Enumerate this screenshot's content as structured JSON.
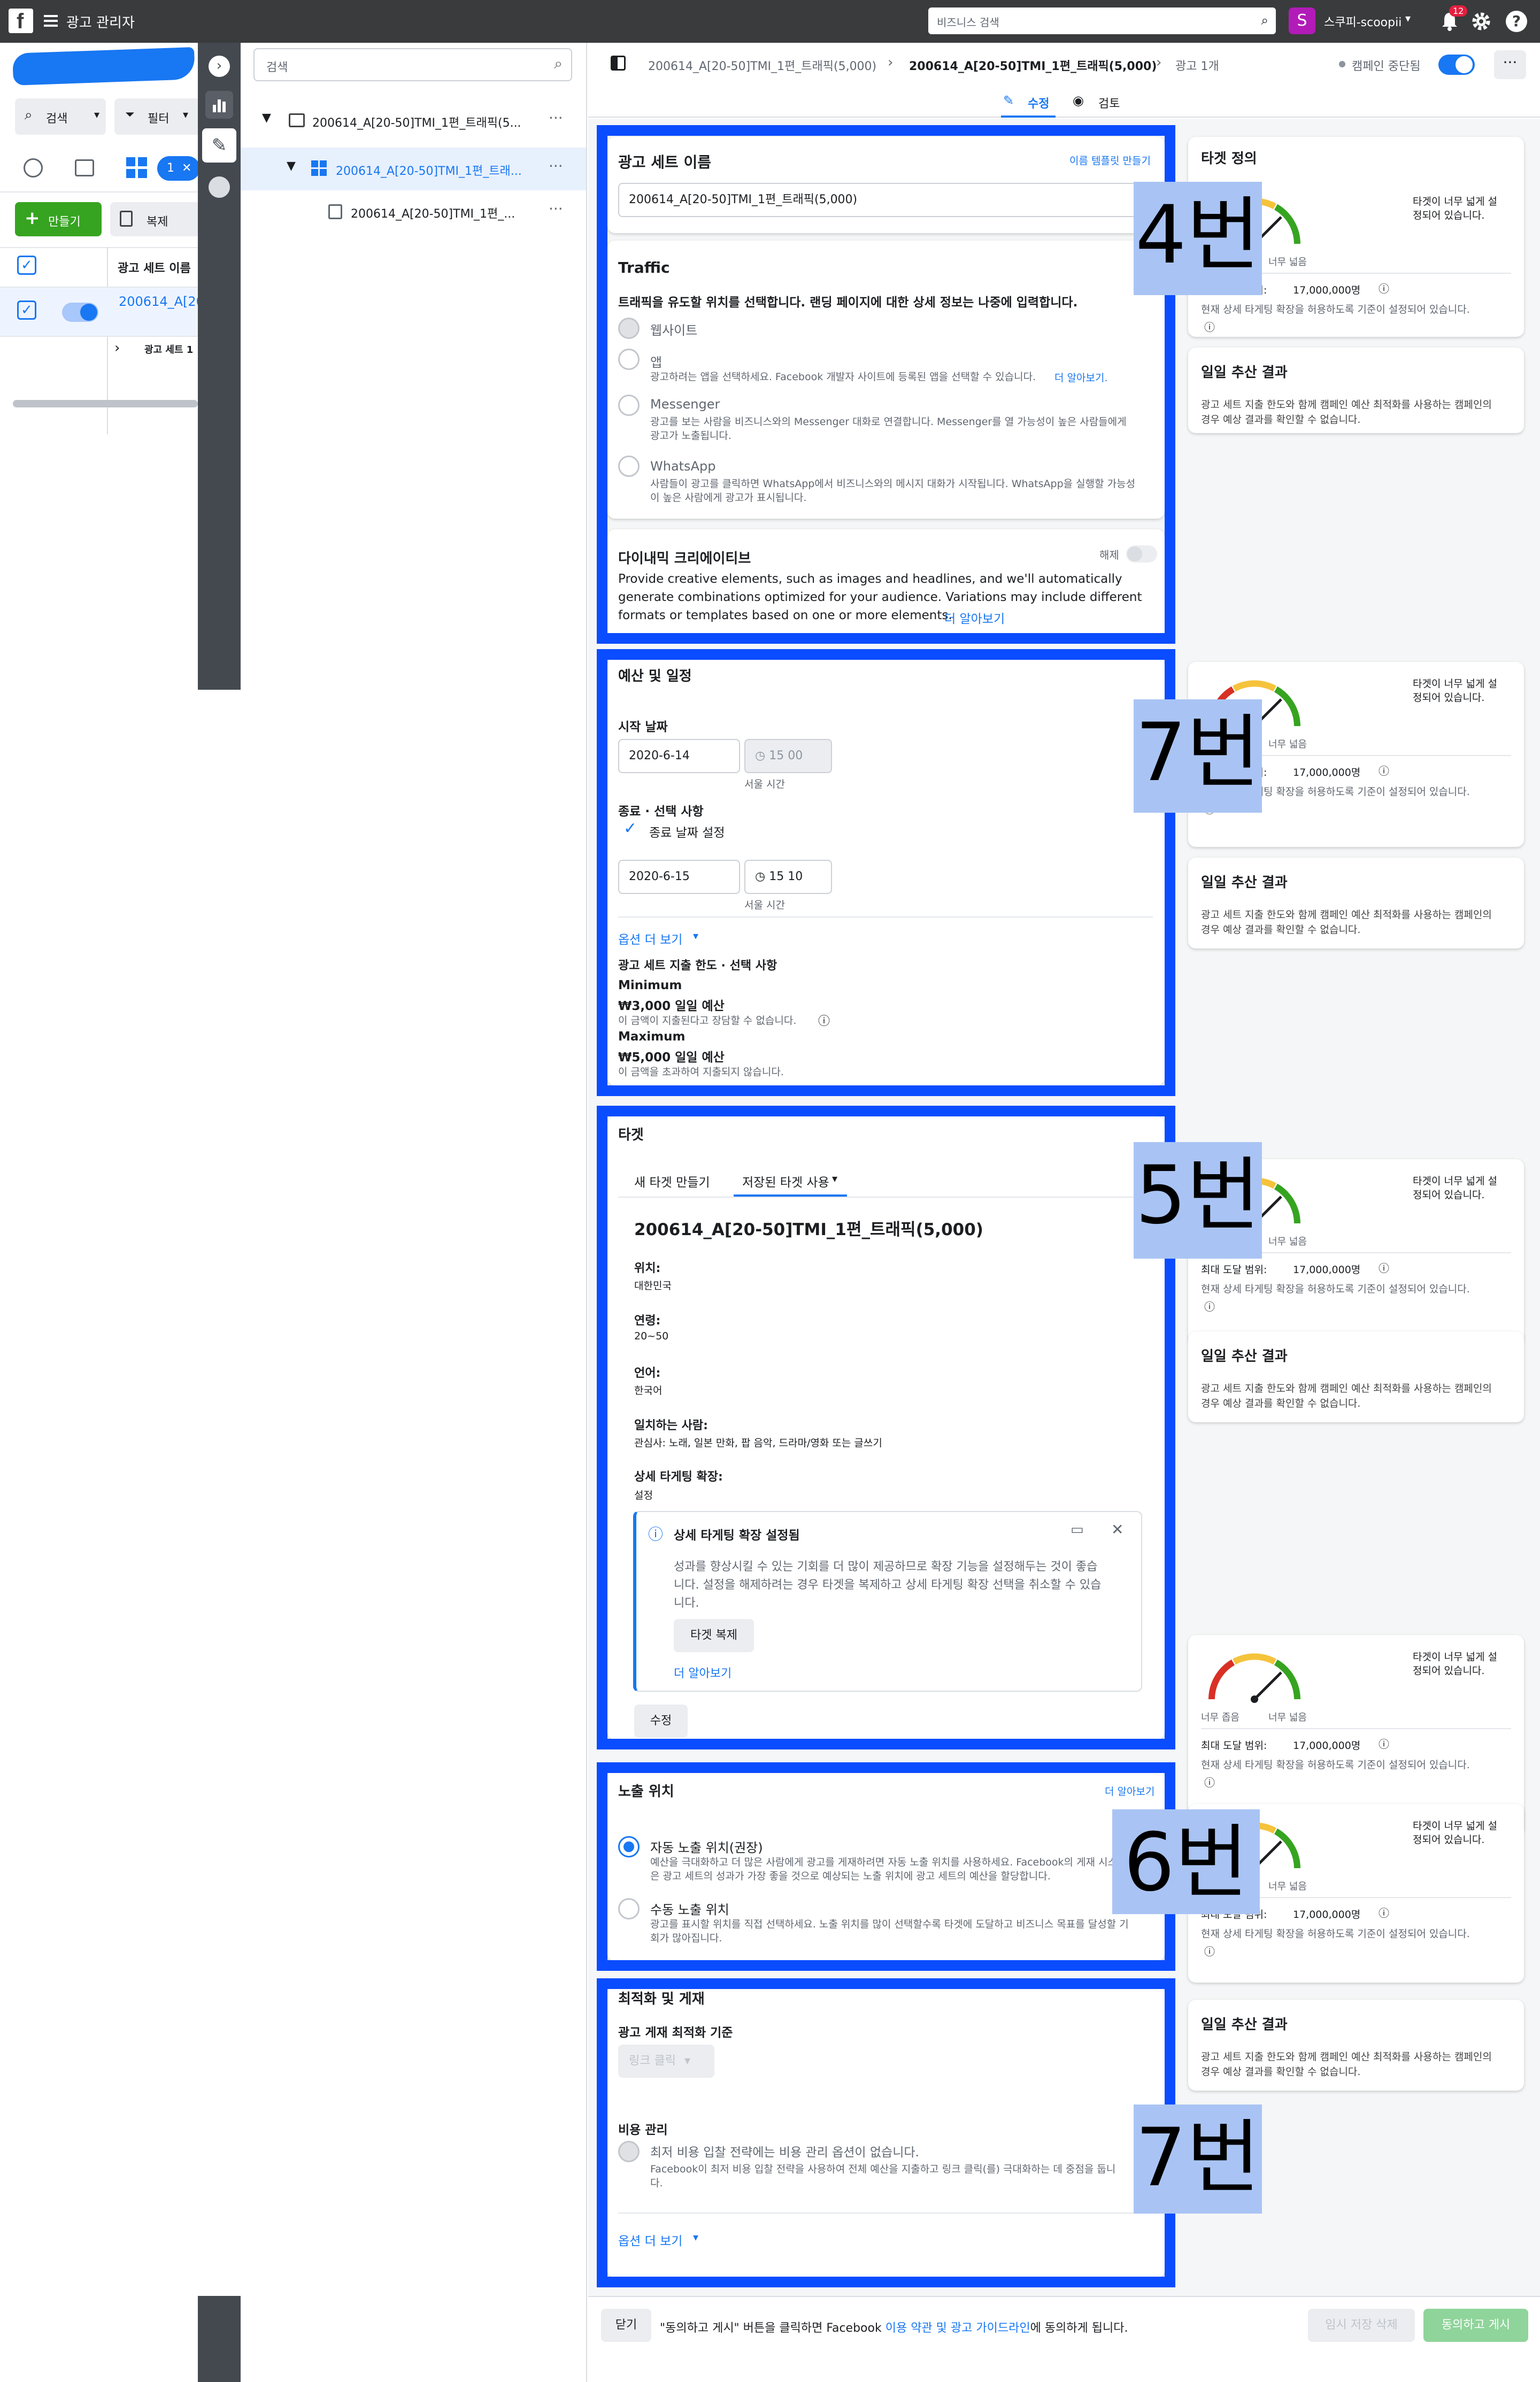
{
  "topbar": {
    "title": "광고 관리자",
    "search_placeholder": "비즈니스 검색",
    "account": "스쿠피-scoopii",
    "notif_count": "12"
  },
  "left": {
    "search_label": "검색",
    "filter_label": "필터",
    "count_chip": "1",
    "create_label": "만들기",
    "copy_label": "복제",
    "col_header": "광고 세트 이름",
    "row_name": "200614_A[20",
    "sub_row": "광고 세트 1"
  },
  "tree": {
    "search_placeholder": "검색",
    "campaign": "200614_A[20-50]TMI_1편_트래픽(5...",
    "adset": "200614_A[20-50]TMI_1편_트래...",
    "ad": "200614_A[20-50]TMI_1편_..."
  },
  "header": {
    "crumb1": "200614_A[20-50]TMI_1편_트래픽(5,000)",
    "crumb2": "200614_A[20-50]TMI_1편_트래픽(5,000)",
    "crumb3": "광고 1개",
    "status": "캠페인 중단됨",
    "tab_edit": "수정",
    "tab_review": "검토"
  },
  "s1": {
    "title": "광고 세트 이름",
    "template_link": "이름 템플릿 만들기",
    "name_value": "200614_A[20-50]TMI_1편_트래픽(5,000)",
    "traffic_title": "Traffic",
    "traffic_desc": "트래픽을 유도할 위치를 선택합니다. 랜딩 페이지에 대한 상세 정보는 나중에 입력합니다.",
    "opt_web": "웹사이트",
    "opt_app": "앱",
    "opt_app_desc": "광고하려는 앱을 선택하세요. Facebook 개발자 사이트에 등록된 앱을 선택할 수 있습니다.",
    "opt_app_link": "더 알아보기.",
    "opt_msg": "Messenger",
    "opt_msg_desc1": "광고를 보는 사람을 비즈니스와의 Messenger 대화로 연결합니다. Messenger를 열 가능성이 높은 사람들에게",
    "opt_msg_desc2": "광고가 노출됩니다.",
    "opt_wa": "WhatsApp",
    "opt_wa_desc1": "사람들이 광고를 클릭하면 WhatsApp에서 비즈니스와의 메시지 대화가 시작됩니다. WhatsApp을 실행할 가능성",
    "opt_wa_desc2": "이 높은 사람에게 광고가 표시됩니다.",
    "dyn_title": "다이내믹 크리에이티브",
    "dyn_toggle": "해제",
    "dyn_desc1": "Provide creative elements, such as images and headlines, and we'll automatically",
    "dyn_desc2": "generate combinations optimized for your audience. Variations may include different",
    "dyn_desc3": "formats or templates based on one or more elements.",
    "dyn_link": "더 알아보기"
  },
  "s2": {
    "title": "예산 및 일정",
    "start_label": "시작 날짜",
    "start_date": "2020-6-14",
    "start_time": "15  00",
    "tz1": "서울 시간",
    "end_label": "종료 · 선택 사항",
    "end_check": "종료 날짜 설정",
    "end_date": "2020-6-15",
    "end_time": "15  10",
    "tz2": "서울 시간",
    "more": "옵션 더 보기",
    "limit_label": "광고 세트 지출 한도 · 선택 사항",
    "min_label": "Minimum",
    "min_value": "₩3,000 일일 예산",
    "min_desc": "이 금액이 지출된다고 장담할 수 없습니다.",
    "max_label": "Maximum",
    "max_value": "₩5,000 일일 예산",
    "max_desc": "이 금액을 초과하여 지출되지 않습니다."
  },
  "s3": {
    "title": "타겟",
    "tab_new": "새 타겟 만들기",
    "tab_saved": "저장된 타겟 사용",
    "aud_name": "200614_A[20-50]TMI_1편_트래픽(5,000)",
    "loc_label": "위치:",
    "loc_value": "대한민국",
    "age_label": "연령:",
    "age_value": "20~50",
    "lang_label": "언어:",
    "lang_value": "한국어",
    "match_label": "일치하는 사람:",
    "match_value": "관심사: 노래, 일본 만화, 팝 음악, 드라마/영화 또는 글쓰기",
    "detail_label": "상세 타게팅 확장:",
    "detail_value": "설정",
    "info_title": "상세 타게팅 확장 설정됨",
    "info_1": "성과를 향상시킬 수 있는 기회를 더 많이 제공하므로 확장 기능을 설정해두는 것이 좋습",
    "info_2": "니다. 설정을 해제하려는 경우 타겟을 복제하고 상세 타게팅 확장 선택을 취소할 수 있습",
    "info_3": "니다.",
    "info_btn": "타겟 복제",
    "info_link": "더 알아보기",
    "edit_btn": "수정"
  },
  "s4": {
    "title": "노출 위치",
    "more_link": "더 알아보기",
    "auto_label": "자동 노출 위치(권장)",
    "auto_desc1": "예산을 극대화하고 더 많은 사람에게 광고를 게재하려면 자동 노출 위치를 사용하세요. Facebook의 게재 시스",
    "auto_desc2": "은 광고 세트의 성과가 가장 좋을 것으로 예상되는 노출 위치에 광고 세트의 예산을 할당합니다.",
    "manual_label": "수동 노출 위치",
    "manual_desc1": "광고를 표시할 위치를 직접 선택하세요. 노출 위치를 많이 선택할수록 타겟에 도달하고 비즈니스 목표를 달성할 기",
    "manual_desc2": "회가 많아집니다."
  },
  "s5": {
    "title": "최적화 및 게재",
    "opt_label": "광고 게재 최적화 기준",
    "opt_value": "링크 클릭",
    "cost_label": "비용 관리",
    "cost_text": "최저 비용 입찰 전략에는 비용 관리 옵션이 없습니다.",
    "cost_desc1": "Facebook이 최저 비용 입찰 전략을 사용하여 전체 예산을 지출하고 링크 클릭(를) 극대화하는 데 중점을 둡니",
    "cost_desc2": "다.",
    "more": "옵션 더 보기"
  },
  "right": {
    "def_title": "타겟 정의",
    "too_wide": "타겟이 너무 넓게 설",
    "too_wide2": "정되어 있습니다.",
    "narrow": "너무 좁음",
    "wide": "너무 넓음",
    "reach_prefix": "최대 도달 범위:",
    "reach": "17,000,000명",
    "reach_short": "위: 17,000,000명",
    "expand_note": "현재 상세 타게팅 확장을 허용하도록 기준이 설정되어 있습니다.",
    "daily_title": "일일 추산 결과",
    "daily_desc1": "광고 세트 지출 한도와 함께 캠페인 예산 최적화를 사용하는 캠페인의",
    "daily_desc2": "경우 예상 결과를 확인할 수 없습니다."
  },
  "annotations": {
    "a4": "4번",
    "a7a": "7번",
    "a5": "5번",
    "a6": "6번",
    "a7b": "7번"
  },
  "footer": {
    "close_btn": "닫기",
    "notice_pre": "\"동의하고 게시\" 버튼을 클릭하면 Facebook",
    "terms_link": "이용 약관 및 광고 가이드라인",
    "notice_post": "에 동의하게 됩니다.",
    "draft_btn": "임시 저장 삭제",
    "publish_btn": "동의하고 게시"
  },
  "colors": {
    "accent": "#1877f2",
    "annotation_border": "#0a4cff",
    "annotation_fill": "#a9c4f4",
    "publish": "#8fd49a"
  }
}
